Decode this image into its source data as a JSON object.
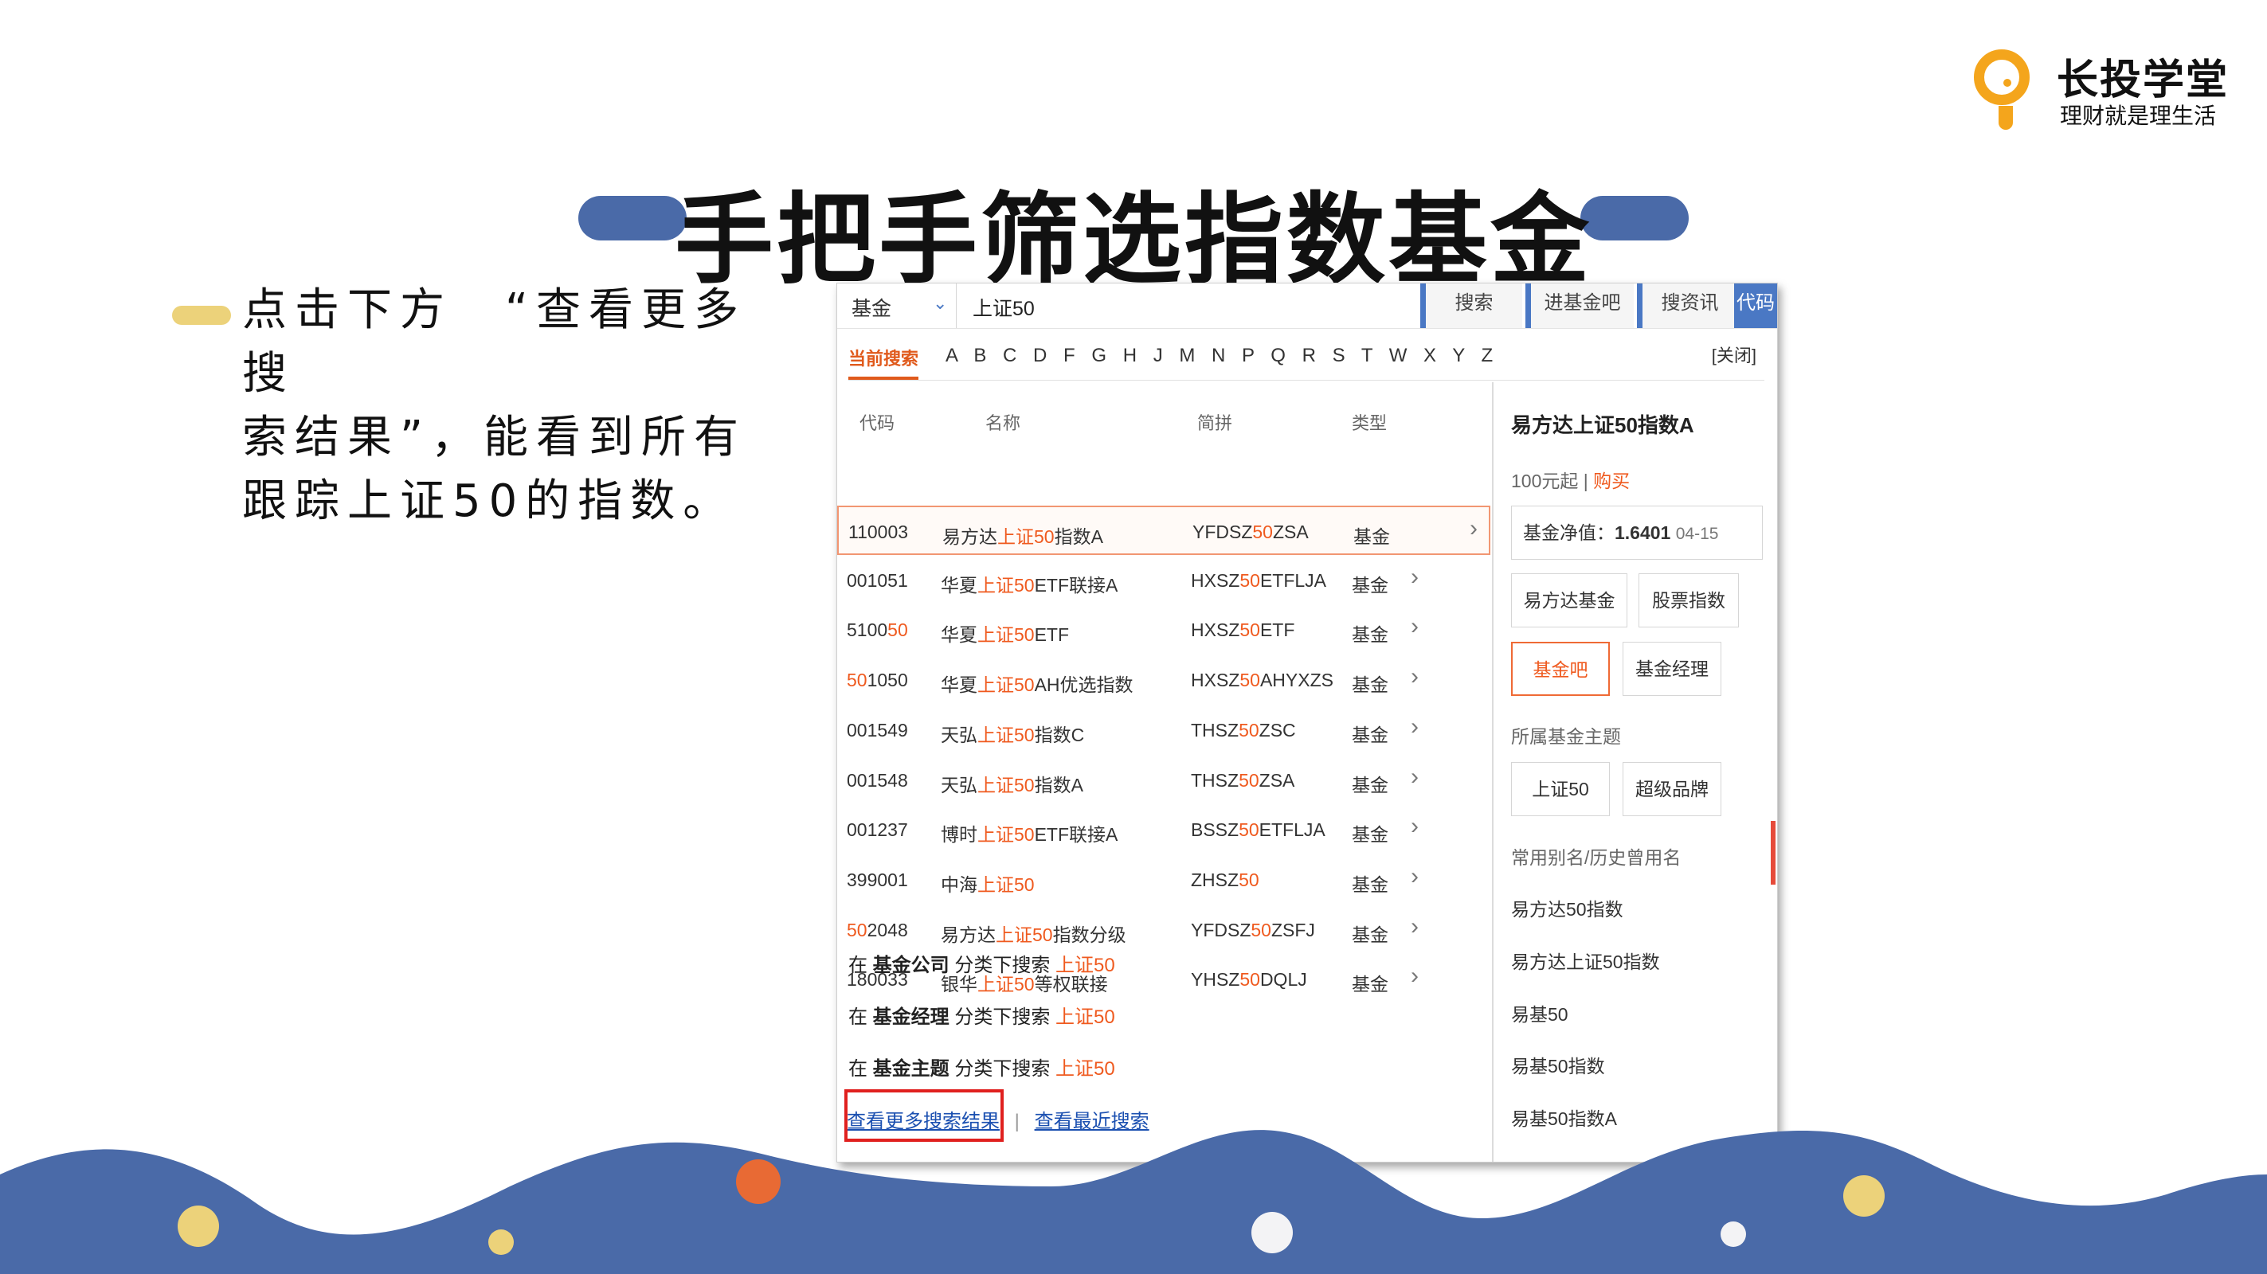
{
  "logo": {
    "title": "长投学堂",
    "subtitle": "理财就是理生活"
  },
  "title": "手把手筛选指数基金",
  "bullet": {
    "lines": [
      "点击下方　“查看更多搜",
      "索结果”，能看到所有",
      "跟踪上证50的指数。"
    ]
  },
  "search": {
    "select_value": "基金",
    "query": "上证50",
    "tabs": [
      "搜索",
      "进基金吧",
      "搜资讯",
      "代码"
    ]
  },
  "alpha": {
    "current": "当前搜索",
    "letters": "A B C D F G H J M N P Q R S T W X Y Z",
    "close": "[关闭]"
  },
  "table": {
    "headers": {
      "code": "代码",
      "name": "名称",
      "pinyin": "简拼",
      "type": "类型"
    },
    "rows": [
      {
        "code_a": "110003",
        "code_b": "",
        "code_c": "",
        "name_a": "易方达",
        "name_b": "上证50",
        "name_c": "指数A",
        "py_a": "YFDSZ",
        "py_b": "50",
        "py_c": "ZSA",
        "type": "基金"
      },
      {
        "code_a": "001051",
        "code_b": "",
        "code_c": "",
        "name_a": "华夏",
        "name_b": "上证50",
        "name_c": "ETF联接A",
        "py_a": "HXSZ",
        "py_b": "50",
        "py_c": "ETFLJA",
        "type": "基金"
      },
      {
        "code_a": "5100",
        "code_b": "50",
        "code_c": "",
        "name_a": "华夏",
        "name_b": "上证50",
        "name_c": "ETF",
        "py_a": "HXSZ",
        "py_b": "50",
        "py_c": "ETF",
        "type": "基金"
      },
      {
        "code_a": "",
        "code_b": "50",
        "code_c": "1050",
        "name_a": "华夏",
        "name_b": "上证50",
        "name_c": "AH优选指数",
        "py_a": "HXSZ",
        "py_b": "50",
        "py_c": "AHYXZS",
        "type": "基金"
      },
      {
        "code_a": "001549",
        "code_b": "",
        "code_c": "",
        "name_a": "天弘",
        "name_b": "上证50",
        "name_c": "指数C",
        "py_a": "THSZ",
        "py_b": "50",
        "py_c": "ZSC",
        "type": "基金"
      },
      {
        "code_a": "001548",
        "code_b": "",
        "code_c": "",
        "name_a": "天弘",
        "name_b": "上证50",
        "name_c": "指数A",
        "py_a": "THSZ",
        "py_b": "50",
        "py_c": "ZSA",
        "type": "基金"
      },
      {
        "code_a": "001237",
        "code_b": "",
        "code_c": "",
        "name_a": "博时",
        "name_b": "上证50",
        "name_c": "ETF联接A",
        "py_a": "BSSZ",
        "py_b": "50",
        "py_c": "ETFLJA",
        "type": "基金"
      },
      {
        "code_a": "399001",
        "code_b": "",
        "code_c": "",
        "name_a": "中海",
        "name_b": "上证50",
        "name_c": "",
        "py_a": "ZHSZ",
        "py_b": "50",
        "py_c": "",
        "type": "基金"
      },
      {
        "code_a": "",
        "code_b": "50",
        "code_c": "2048",
        "name_a": "易方达",
        "name_b": "上证50",
        "name_c": "指数分级",
        "py_a": "YFDSZ",
        "py_b": "50",
        "py_c": "ZSFJ",
        "type": "基金"
      },
      {
        "code_a": "180033",
        "code_b": "",
        "code_c": "",
        "name_a": "银华",
        "name_b": "上证50",
        "name_c": "等权联接",
        "py_a": "YHSZ",
        "py_b": "50",
        "py_c": "DQLJ",
        "type": "基金"
      }
    ],
    "chevron": "›"
  },
  "more": [
    {
      "pre": "在",
      "cat": "基金公司",
      "mid": "分类下搜索",
      "q": "上证50"
    },
    {
      "pre": "在",
      "cat": "基金经理",
      "mid": "分类下搜索",
      "q": "上证50"
    },
    {
      "pre": "在",
      "cat": "基金主题",
      "mid": "分类下搜索",
      "q": "上证50"
    }
  ],
  "links": {
    "more_results": "查看更多搜索结果",
    "sep": "|",
    "recent": "查看最近搜索"
  },
  "detail": {
    "fund_name": "易方达上证50指数A",
    "min_buy": "100元起",
    "sep": "|",
    "buy": "购买",
    "nav_label": "基金净值：",
    "nav_value": "1.6401",
    "nav_date": "04-15",
    "buttons1": [
      "易方达基金",
      "股票指数"
    ],
    "buttons2": [
      "基金吧",
      "基金经理"
    ],
    "theme_label": "所属基金主题",
    "theme_buttons": [
      "上证50",
      "超级品牌"
    ],
    "alias_label": "常用别名/历史曾用名",
    "aliases": [
      "易方达50指数",
      "易方达上证50指数",
      "易基50",
      "易基50指数",
      "易基50指数A"
    ]
  },
  "colors": {
    "accent_orange": "#ef5a1f",
    "brand_blue": "#4a6aa8",
    "logo_yellow": "#f4a51c"
  }
}
